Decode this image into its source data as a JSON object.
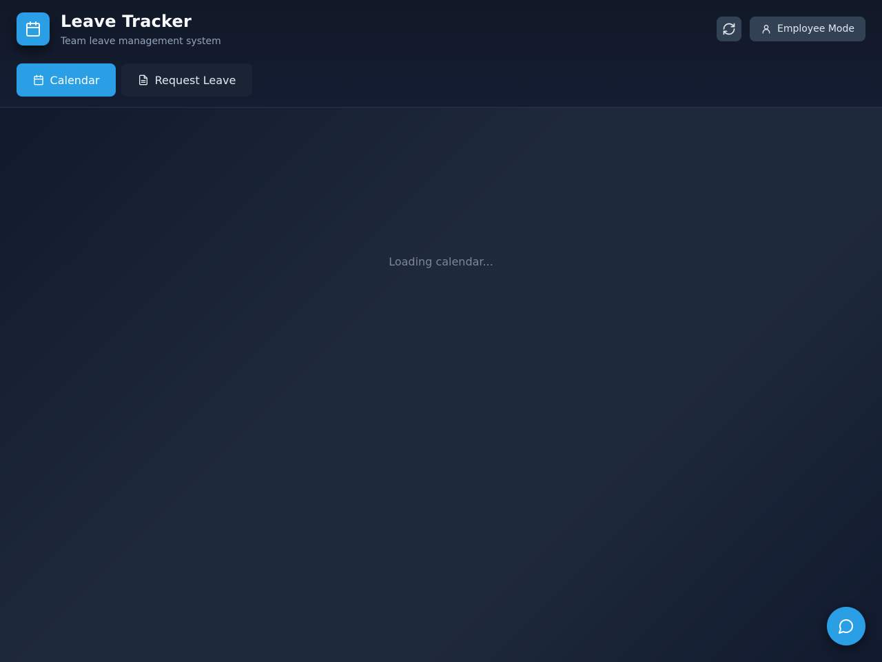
{
  "app": {
    "title": "Leave Tracker",
    "subtitle": "Team leave management system",
    "logo_icon": "calendar-icon"
  },
  "header": {
    "refresh_icon": "refresh-icon",
    "mode_label": "Employee Mode",
    "mode_icon": "user-icon"
  },
  "tabs": [
    {
      "label": "Calendar",
      "icon": "calendar-icon",
      "active": true
    },
    {
      "label": "Request Leave",
      "icon": "document-icon",
      "active": false
    }
  ],
  "main": {
    "status_text": "Loading calendar..."
  },
  "chat": {
    "icon": "chat-bubble-icon"
  },
  "colors": {
    "accent": "#2b9fe6",
    "background": "#1e293b",
    "header": "#111827",
    "button_muted": "#334155"
  }
}
